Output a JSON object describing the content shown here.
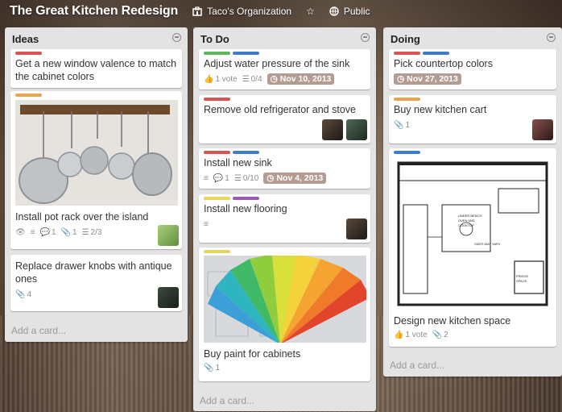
{
  "header": {
    "board_title": "The Great Kitchen Redesign",
    "organization": "Taco's Organization",
    "visibility": "Public"
  },
  "colors": {
    "green": "#5cb85c",
    "blue": "#3d7ccb",
    "red": "#d9534f",
    "orange": "#e8a54d",
    "yellow": "#e6d65e",
    "purple": "#9b59b6",
    "due_bg": "#b49c93"
  },
  "lists": [
    {
      "title": "Ideas",
      "add_card": "Add a card...",
      "cards": [
        {
          "title": "Get a new window valence to match the cabinet colors",
          "labels": [
            "red"
          ]
        },
        {
          "title": "Install pot rack over the island",
          "labels": [
            "orange"
          ],
          "badges": {
            "comments": "1",
            "attachments": "1",
            "checklist": "2/3"
          }
        },
        {
          "title": "Replace drawer knobs with antique ones",
          "badges": {
            "attachments": "4"
          }
        }
      ]
    },
    {
      "title": "To Do",
      "add_card": "Add a card...",
      "cards": [
        {
          "title": "Adjust water pressure of the sink",
          "labels": [
            "green",
            "blue"
          ],
          "badges": {
            "votes": "1 vote",
            "checklist": "0/4",
            "due": "Nov 10, 2013"
          }
        },
        {
          "title": "Remove old refrigerator and stove",
          "labels": [
            "red"
          ]
        },
        {
          "title": "Install new sink",
          "labels": [
            "red",
            "blue"
          ],
          "badges": {
            "comments": "1",
            "checklist": "0/10",
            "due": "Nov 4, 2013"
          }
        },
        {
          "title": "Install new flooring",
          "labels": [
            "yellow",
            "purple"
          ]
        },
        {
          "title": "Buy paint for cabinets",
          "labels": [
            "yellow"
          ],
          "badges": {
            "attachments": "1"
          }
        }
      ]
    },
    {
      "title": "Doing",
      "add_card": "Add a card...",
      "cards": [
        {
          "title": "Pick countertop colors",
          "labels": [
            "red",
            "blue"
          ],
          "badges": {
            "due": "Nov 27, 2013"
          }
        },
        {
          "title": "Buy new kitchen cart",
          "labels": [
            "orange"
          ],
          "badges": {
            "attachments": "1"
          }
        },
        {
          "title": "Design new kitchen space",
          "labels": [
            "blue"
          ],
          "badges": {
            "votes": "1 vote",
            "attachments": "2"
          }
        }
      ]
    }
  ]
}
